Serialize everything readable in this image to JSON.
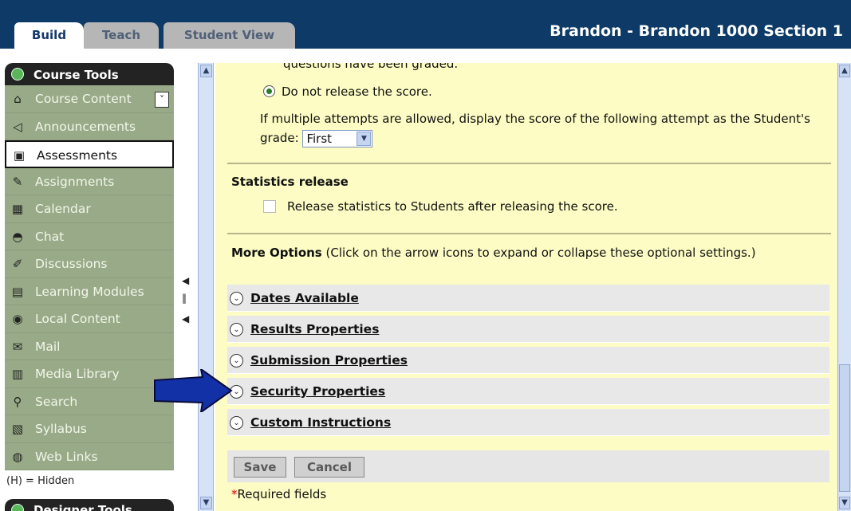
{
  "header": {
    "tabs": [
      {
        "label": "Build"
      },
      {
        "label": "Teach"
      },
      {
        "label": "Student View"
      }
    ],
    "course_title": "Brandon - Brandon 1000 Section 1",
    "color": "#0d3a66"
  },
  "sidebar": {
    "section_title": "Course Tools",
    "items": [
      {
        "label": "Course Content",
        "icon": "house-icon"
      },
      {
        "label": "Announcements",
        "icon": "megaphone-icon"
      },
      {
        "label": "Assessments",
        "icon": "assessment-icon",
        "active": true
      },
      {
        "label": "Assignments",
        "icon": "assignment-icon"
      },
      {
        "label": "Calendar",
        "icon": "calendar-icon"
      },
      {
        "label": "Chat",
        "icon": "chat-icon"
      },
      {
        "label": "Discussions",
        "icon": "discussion-icon"
      },
      {
        "label": "Learning Modules",
        "icon": "module-icon"
      },
      {
        "label": "Local Content",
        "icon": "local-content-icon"
      },
      {
        "label": "Mail",
        "icon": "mail-icon"
      },
      {
        "label": "Media Library",
        "icon": "media-library-icon"
      },
      {
        "label": "Search",
        "icon": "search-icon"
      },
      {
        "label": "Syllabus",
        "icon": "syllabus-icon"
      },
      {
        "label": "Web Links",
        "icon": "web-links-icon"
      }
    ],
    "hidden_note": "(H) = Hidden",
    "designer_title": "Designer Tools"
  },
  "main": {
    "cut_text": "questions have been graded.",
    "radio_label": "Do not release the score.",
    "multiple_attempts_text": "If multiple attempts are allowed, display the score of the following attempt as the Student's grade:",
    "grade_select_value": "First",
    "statistics": {
      "title": "Statistics release",
      "checkbox_label": "Release statistics to Students after releasing the score."
    },
    "more_options": {
      "title": "More Options",
      "hint": "(Click on the arrow icons to expand or collapse these optional settings.)"
    },
    "option_rows": [
      {
        "label": "Dates Available"
      },
      {
        "label": "Results Properties"
      },
      {
        "label": "Submission Properties"
      },
      {
        "label": "Security Properties"
      },
      {
        "label": "Custom Instructions"
      }
    ],
    "save_label": "Save",
    "cancel_label": "Cancel",
    "required_star": "*",
    "required_text": "Required fields"
  }
}
